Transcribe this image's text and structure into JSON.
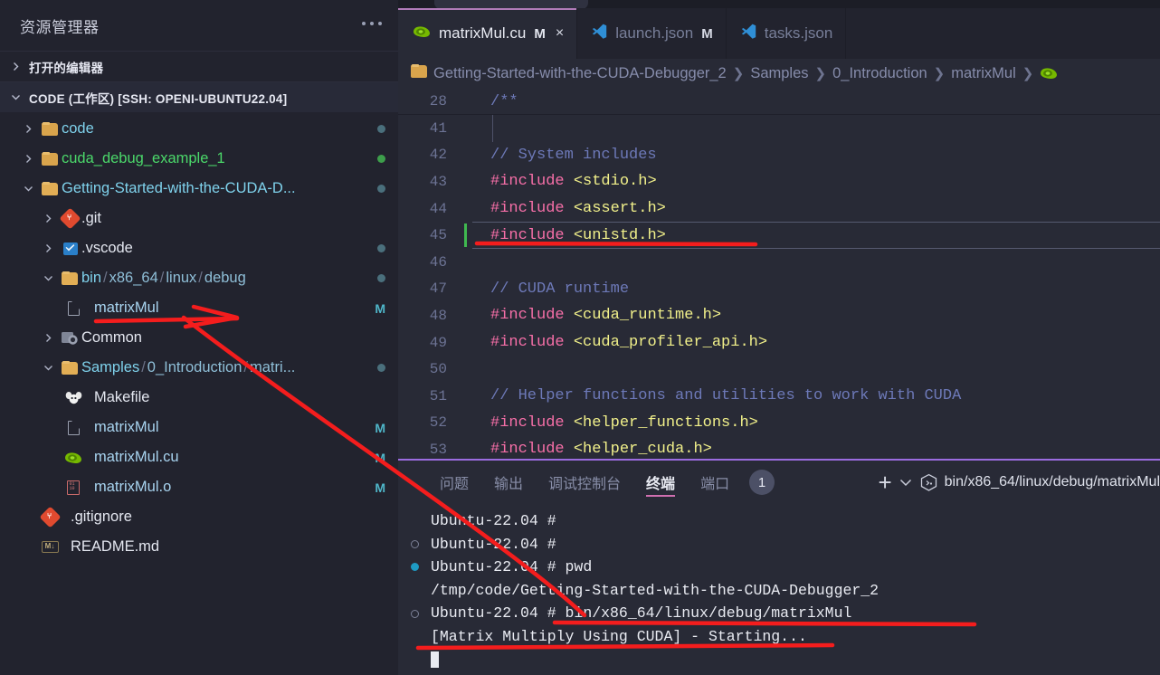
{
  "sidebar": {
    "title": "资源管理器",
    "more_icon": "ellipsis-icon",
    "sections": [
      {
        "label": "打开的编辑器",
        "expanded": false
      },
      {
        "label": "CODE (工作区) [SSH: OPENI-UBUNTU22.04]",
        "expanded": true
      }
    ],
    "tree": [
      {
        "label": "code",
        "icon": "folder-icon",
        "twisty": "chevron-right",
        "indent": 1,
        "kind": "folder",
        "status": "dot",
        "status_color": "#4a6f7c"
      },
      {
        "label": "cuda_debug_example_1",
        "icon": "folder-icon",
        "twisty": "chevron-right",
        "indent": 1,
        "kind": "folder",
        "status": "dot",
        "status_color": "#3d9e4b"
      },
      {
        "label": "Getting-Started-with-the-CUDA-D...",
        "icon": "folder-open-icon",
        "twisty": "chevron-down",
        "indent": 1,
        "kind": "folder",
        "status": "dot",
        "status_color": "#4a6f7c"
      },
      {
        "label": ".git",
        "icon": "git-folder-icon",
        "twisty": "chevron-right",
        "indent": 2,
        "kind": "folder",
        "status": ""
      },
      {
        "label": ".vscode",
        "icon": "vscode-folder-icon",
        "twisty": "chevron-right",
        "indent": 2,
        "kind": "folder",
        "status": "dot",
        "status_color": "#4a6f7c"
      },
      {
        "label": "bin/x86_64/linux/debug",
        "segments": [
          "bin",
          "x86_64",
          "linux",
          "debug"
        ],
        "icon": "folder-open-icon",
        "twisty": "chevron-down",
        "indent": 2,
        "kind": "folder-path",
        "status": "dot",
        "status_color": "#4a6f7c"
      },
      {
        "label": "matrixMul",
        "icon": "file-icon",
        "twisty": "",
        "indent": 3,
        "kind": "file",
        "status": "M"
      },
      {
        "label": "Common",
        "icon": "cpp-folder-icon",
        "twisty": "chevron-right",
        "indent": 2,
        "kind": "folder",
        "status": ""
      },
      {
        "label": "Samples/0_Introduction/matri...",
        "segments": [
          "Samples",
          "0_Introduction",
          "matri..."
        ],
        "icon": "folder-open-icon",
        "twisty": "chevron-down",
        "indent": 2,
        "kind": "folder-path",
        "status": "dot",
        "status_color": "#4a6f7c"
      },
      {
        "label": "Makefile",
        "icon": "makefile-icon",
        "twisty": "",
        "indent": 3,
        "kind": "file",
        "status": ""
      },
      {
        "label": "matrixMul",
        "icon": "file-icon",
        "twisty": "",
        "indent": 3,
        "kind": "file",
        "status": "M"
      },
      {
        "label": "matrixMul.cu",
        "icon": "cuda-icon",
        "twisty": "",
        "indent": 3,
        "kind": "file",
        "status": "M"
      },
      {
        "label": "matrixMul.o",
        "icon": "binary-icon",
        "twisty": "",
        "indent": 3,
        "kind": "file",
        "status": "M"
      },
      {
        "label": ".gitignore",
        "icon": "git-icon",
        "twisty": "",
        "indent": 2,
        "kind": "file",
        "status": ""
      },
      {
        "label": "README.md",
        "icon": "markdown-icon",
        "twisty": "",
        "indent": 2,
        "kind": "file",
        "status": ""
      }
    ]
  },
  "tabs": [
    {
      "name": "matrixMul.cu",
      "icon": "cuda-icon",
      "modified": "M",
      "active": true,
      "close": "×"
    },
    {
      "name": "launch.json",
      "icon": "vscode-icon",
      "modified": "M",
      "active": false
    },
    {
      "name": "tasks.json",
      "icon": "vscode-icon",
      "modified": "",
      "active": false
    }
  ],
  "breadcrumb": {
    "root_icon": "folder-icon",
    "items": [
      "Getting-Started-with-the-CUDA-Debugger_2",
      "Samples",
      "0_Introduction",
      "matrixMul"
    ],
    "separator": "›",
    "trailing_icon": "cuda-icon"
  },
  "editor": {
    "lines": [
      {
        "num": "28",
        "text": "/**",
        "type": "comment",
        "folded_after": true
      },
      {
        "num": "41",
        "text": "",
        "type": "plain"
      },
      {
        "num": "42",
        "text": "// System includes",
        "type": "comment"
      },
      {
        "num": "43",
        "text": "#include <stdio.h>",
        "type": "include",
        "kw": "#include",
        "arg": " <stdio.h>"
      },
      {
        "num": "44",
        "text": "#include <assert.h>",
        "type": "include",
        "kw": "#include",
        "arg": " <assert.h>"
      },
      {
        "num": "45",
        "text": "#include <unistd.h>",
        "type": "include",
        "kw": "#include",
        "arg": " <unistd.h>",
        "current": true,
        "modified": true
      },
      {
        "num": "46",
        "text": "",
        "type": "plain"
      },
      {
        "num": "47",
        "text": "// CUDA runtime",
        "type": "comment"
      },
      {
        "num": "48",
        "text": "#include <cuda_runtime.h>",
        "type": "include",
        "kw": "#include",
        "arg": " <cuda_runtime.h>"
      },
      {
        "num": "49",
        "text": "#include <cuda_profiler_api.h>",
        "type": "include",
        "kw": "#include",
        "arg": " <cuda_profiler_api.h>"
      },
      {
        "num": "50",
        "text": "",
        "type": "plain"
      },
      {
        "num": "51",
        "text": "// Helper functions and utilities to work with CUDA",
        "type": "comment"
      },
      {
        "num": "52",
        "text": "#include <helper_functions.h>",
        "type": "include",
        "kw": "#include",
        "arg": " <helper_functions.h>"
      },
      {
        "num": "53",
        "text": "#include <helper_cuda.h>",
        "type": "include",
        "kw": "#include",
        "arg": " <helper_cuda.h>"
      }
    ]
  },
  "panel": {
    "tabs": [
      {
        "label": "问题",
        "active": false
      },
      {
        "label": "输出",
        "active": false
      },
      {
        "label": "调试控制台",
        "active": false
      },
      {
        "label": "终端",
        "active": true
      },
      {
        "label": "端口",
        "active": false,
        "badge": "1"
      }
    ],
    "add_icon": "plus-icon",
    "split_icon": "chevron-down-icon",
    "terminal_icon": "terminal-cube-icon",
    "terminal_name": "bin/x86_64/linux/debug/matrixMul",
    "terminal_lines": [
      {
        "mark": "",
        "text": "Ubuntu-22.04 # "
      },
      {
        "mark": "circle",
        "text": "Ubuntu-22.04 # "
      },
      {
        "mark": "circle-filled",
        "text": "Ubuntu-22.04 # pwd"
      },
      {
        "mark": "",
        "text": "/tmp/code/Getting-Started-with-the-CUDA-Debugger_2"
      },
      {
        "mark": "circle",
        "text": "Ubuntu-22.04 # bin/x86_64/linux/debug/matrixMul"
      },
      {
        "mark": "",
        "text": "[Matrix Multiply Using CUDA] - Starting..."
      },
      {
        "mark": "",
        "text": "",
        "cursor": true
      }
    ]
  },
  "annotations": {
    "color": "#f41d1d",
    "shapes": [
      "underline-matrixMul-tree",
      "arrow-to-matrixMul",
      "underline-unistd-include",
      "underline-terminal-command",
      "underline-matrix-multiply-output"
    ]
  }
}
